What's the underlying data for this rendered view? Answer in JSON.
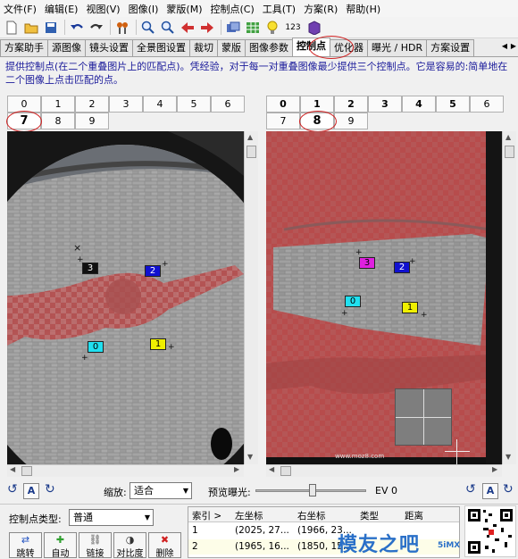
{
  "menubar": {
    "items": [
      "文件(F)",
      "编辑(E)",
      "视图(V)",
      "图像(I)",
      "蒙版(M)",
      "控制点(C)",
      "工具(T)",
      "方案(R)",
      "帮助(H)"
    ]
  },
  "toolbar": {
    "icons": [
      "new-document-icon",
      "open-folder-icon",
      "save-icon",
      "undo-icon",
      "redo-icon",
      "control-points-icon",
      "zoom-in-icon",
      "zoom-out-icon",
      "previous-icon",
      "next-icon",
      "preview-icon",
      "fast-preview-icon",
      "lightbulb-icon",
      "numbers-icon",
      "stitch-icon"
    ],
    "numbers_label": "123"
  },
  "tabs": {
    "items": [
      "方案助手",
      "源图像",
      "镜头设置",
      "全景图设置",
      "裁切",
      "蒙版",
      "图像参数",
      "控制点",
      "优化器",
      "曝光 / HDR",
      "方案设置"
    ],
    "active_index": 7
  },
  "instructions": {
    "line1": "提供控制点(在二个重叠图片上的匹配点)。凭经验，对于每一对重叠图像最少提供三个控制点。它是容易的:简单地在",
    "line2": "二个图像上点击匹配的点。"
  },
  "left_image_tabs": {
    "row1": [
      "0",
      "1",
      "2",
      "3",
      "4",
      "5",
      "6"
    ],
    "row2": [
      "7",
      "8",
      "9"
    ],
    "selected": "7"
  },
  "right_image_tabs": {
    "row1": [
      "0",
      "1",
      "2",
      "3",
      "4",
      "5",
      "6"
    ],
    "row2": [
      "7",
      "8",
      "9"
    ],
    "selected": "8"
  },
  "left_points": [
    {
      "label": "3",
      "bg": "#111111",
      "fg": "#ffffff"
    },
    {
      "label": "2",
      "bg": "#1010d0",
      "fg": "#ffffff"
    },
    {
      "label": "0",
      "bg": "#20e0f0",
      "fg": "#000000"
    },
    {
      "label": "1",
      "bg": "#f0f000",
      "fg": "#000000"
    }
  ],
  "right_points": [
    {
      "label": "3",
      "bg": "#e020e0",
      "fg": "#000000"
    },
    {
      "label": "2",
      "bg": "#1010d0",
      "fg": "#ffffff"
    },
    {
      "label": "0",
      "bg": "#20e0f0",
      "fg": "#000000"
    },
    {
      "label": "1",
      "bg": "#f0f000",
      "fg": "#000000"
    }
  ],
  "controls": {
    "auto_add_label": "A",
    "zoom_label": "缩放:",
    "zoom_value": "适合",
    "preview_exposure_label": "预览曝光:",
    "ev_value": "EV 0",
    "right_auto_add_label": "A"
  },
  "bottom": {
    "cp_type_label": "控制点类型:",
    "cp_type_value": "普通",
    "buttons": [
      {
        "label": "跳转",
        "icon": "jump-icon"
      },
      {
        "label": "自动",
        "icon": "auto-icon"
      },
      {
        "label": "链接",
        "icon": "link-icon"
      },
      {
        "label": "对比度",
        "icon": "contrast-icon"
      },
      {
        "label": "删除",
        "icon": "delete-icon"
      }
    ]
  },
  "table": {
    "headers": [
      "索引 >",
      "左坐标",
      "右坐标",
      "类型",
      "距离"
    ],
    "rows": [
      [
        "1",
        "(2025, 27...",
        "(1966, 23..."
      ],
      [
        "2",
        "(1965, 16...",
        "(1850, 15..."
      ]
    ]
  },
  "watermark": {
    "text": "模友之吧",
    "sub": "5iMX",
    "url": "www.moz8.com"
  },
  "colors": {
    "mask": "#c84040",
    "instructions_text": "#1a1a9a",
    "highlight_ring": "#d02020"
  }
}
